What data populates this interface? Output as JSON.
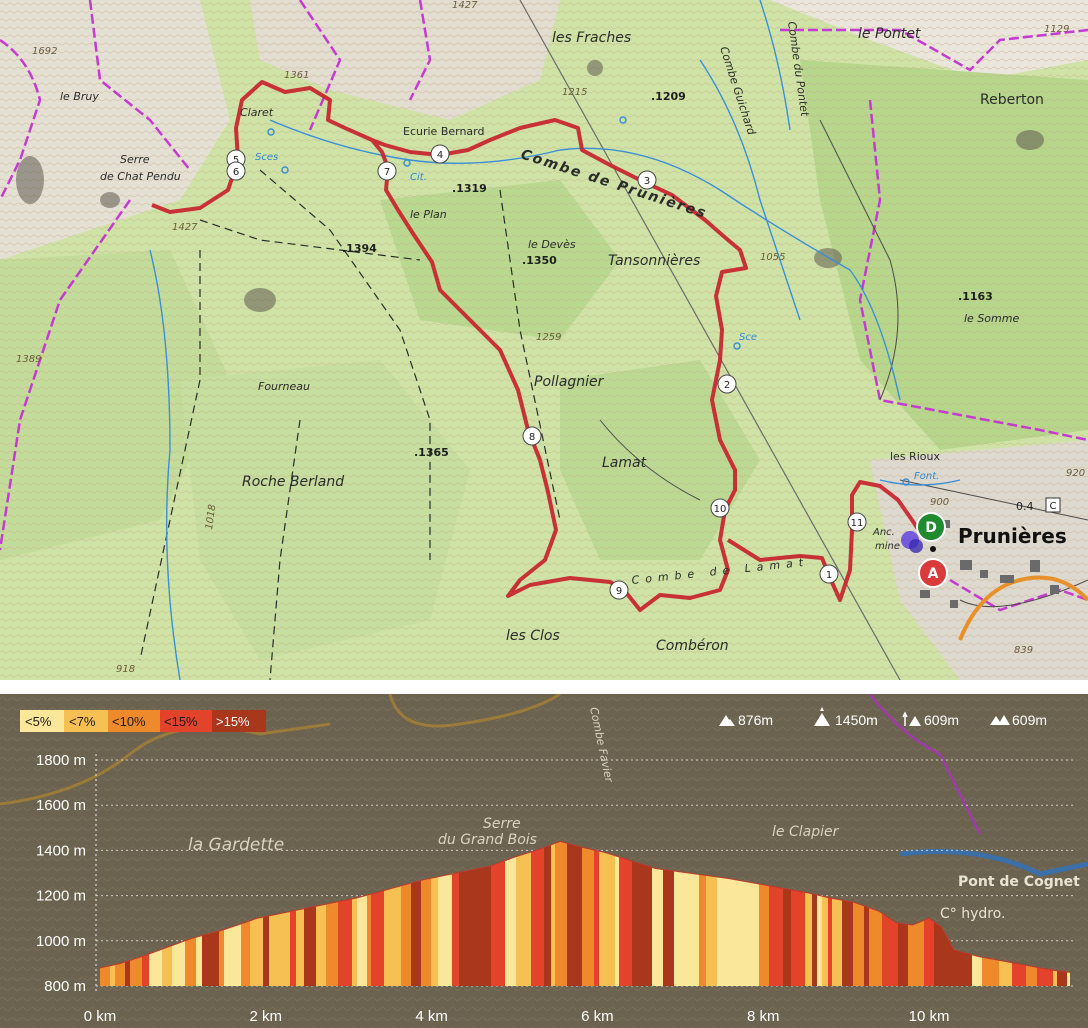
{
  "map": {
    "places": {
      "les_fraches": "les Fraches",
      "le_pontet": "le Pontet",
      "reberton": "Reberton",
      "le_bruy": "le Bruy",
      "serre_line1": "Serre",
      "serre_line2": "de Chat Pendu",
      "claret": "Claret",
      "ecurie_bernard": "Ecurie Bernard",
      "combe_de_prunieres": "Combe de Prunières",
      "combe_guichard": "Combe Guichard",
      "combe_du_pontet": "Combe du Pontet",
      "le_plan": "le Plan",
      "le_deves": "le Devès",
      "tansonnieres": "Tansonnières",
      "le_somme": "le Somme",
      "pollagnier": "Pollagnier",
      "fourneau": "Fourneau",
      "lamat": "Lamat",
      "roche_berland": "Roche Berland",
      "les_rioux": "les Rioux",
      "prunieres": "Prunières",
      "combe_de_lamat": "Combe de Lamat",
      "les_clos": "les Clos",
      "comberon": "Combéron",
      "anc_mine_1": "Anc.",
      "anc_mine_2": "mine"
    },
    "spot_heights": {
      "h1427_top": "1427",
      "h1692": "1692",
      "h1361": "1361",
      "h1215": "1215",
      "h1209": ".1209",
      "h1129": "1129",
      "h1427_left": "1427",
      "h1394": ".1394",
      "h1319": ".1319",
      "h1350": ".1350",
      "h1055": "1055",
      "h1163": ".1163",
      "h1259": "1259",
      "h1389": "1389",
      "h1365": ".1365",
      "h1018": "1018",
      "h918": "918",
      "h920": "920",
      "h839": "839",
      "h900": "900",
      "h0_4": "0.4"
    },
    "water_labels": {
      "sces": "Sces",
      "cit": "Cit.",
      "sce": "Sce",
      "font": "Font."
    },
    "waypoints": [
      "1",
      "2",
      "3",
      "4",
      "5",
      "6",
      "7",
      "8",
      "9",
      "10",
      "11"
    ],
    "markers": {
      "departure": "D",
      "arrival": "A",
      "c_sign": "C"
    },
    "colors": {
      "terrain_green": "#cfe3a6",
      "forest_green": "#b4d58c",
      "route_red": "#c8232c",
      "boundary_magenta": "#c53ad0",
      "water_blue": "#3a8fd8",
      "departure_green": "#1f8a2e",
      "arrival_red": "#d93a3a"
    }
  },
  "profile": {
    "legend": [
      "<5%",
      "<7%",
      "<10%",
      "<15%",
      ">15%"
    ],
    "legend_colors": [
      "#fbe79a",
      "#f6c052",
      "#ef8a2c",
      "#e2432a",
      "#a8371c"
    ],
    "stats": {
      "ascent": "876m",
      "max_altitude": "1450m",
      "min_altitude": "609m",
      "descent": "609m"
    },
    "stat_icons": [
      "ascent-icon",
      "max-altitude-icon",
      "min-altitude-icon",
      "descent-icon"
    ],
    "y_labels": [
      "1800 m",
      "1600 m",
      "1400 m",
      "1200 m",
      "1000 m",
      "800 m"
    ],
    "x_labels": [
      "0 km",
      "2 km",
      "4 km",
      "6 km",
      "8 km",
      "10 km"
    ],
    "background_labels": {
      "la_gardette": "la Gardette",
      "serre_du_grand_bois_1": "Serre",
      "serre_du_grand_bois_2": "du Grand Bois",
      "le_clapier": "le Clapier",
      "pont_de_cognet": "Pont de Cognet",
      "c_hydro": "C° hydro.",
      "combe_favier": "Combe Favier"
    }
  },
  "chart_data": {
    "type": "area",
    "xlabel": "",
    "ylabel": "",
    "ylim": [
      800,
      1800
    ],
    "xlim": [
      0,
      11.7
    ],
    "x_ticks_km": [
      0,
      2,
      4,
      6,
      8,
      10
    ],
    "y_ticks_m": [
      800,
      1000,
      1200,
      1400,
      1600,
      1800
    ],
    "x": [
      0,
      0.25,
      0.5,
      0.8,
      1.1,
      1.5,
      1.9,
      2.3,
      2.7,
      3.1,
      3.5,
      3.9,
      4.3,
      4.7,
      5.0,
      5.3,
      5.55,
      5.8,
      6.1,
      6.4,
      6.7,
      7.0,
      7.3,
      7.6,
      7.9,
      8.2,
      8.5,
      8.8,
      9.1,
      9.4,
      9.6,
      9.8,
      10.0,
      10.15,
      10.3,
      10.6,
      10.9,
      11.2,
      11.5,
      11.7
    ],
    "y": [
      880,
      900,
      930,
      970,
      1010,
      1050,
      1100,
      1130,
      1160,
      1190,
      1230,
      1270,
      1300,
      1330,
      1370,
      1405,
      1440,
      1415,
      1390,
      1355,
      1320,
      1305,
      1290,
      1275,
      1255,
      1235,
      1215,
      1190,
      1170,
      1130,
      1080,
      1070,
      1100,
      1060,
      960,
      930,
      910,
      890,
      870,
      860
    ],
    "slope_classes": [
      "<5%",
      "<7%",
      "<10%",
      "<15%",
      ">15%"
    ]
  }
}
